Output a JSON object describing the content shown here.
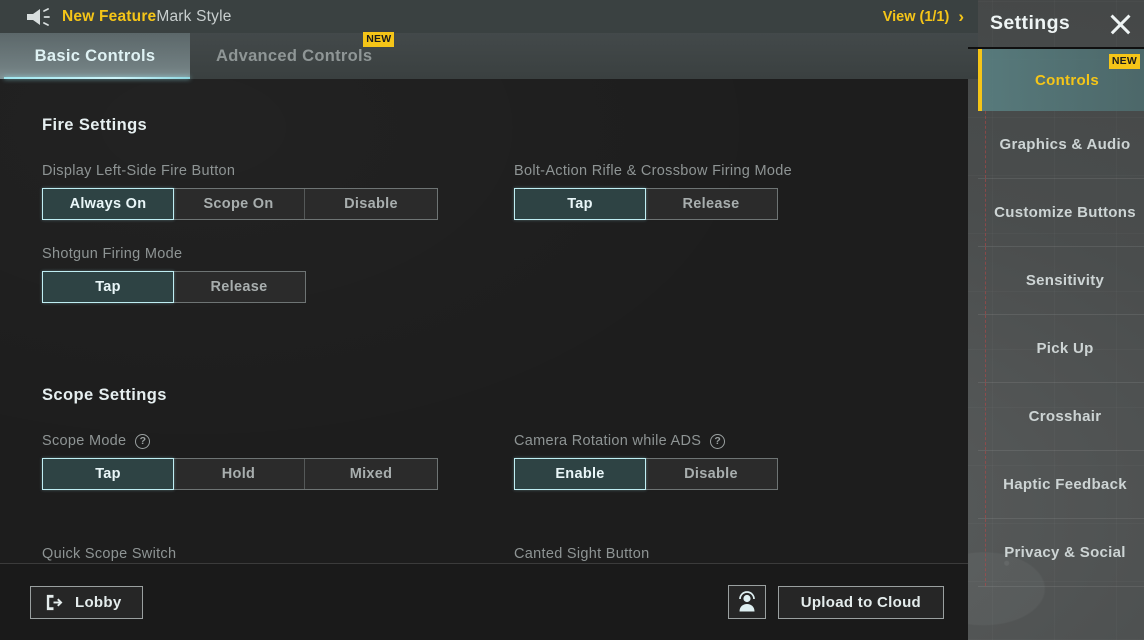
{
  "banner": {
    "icon": "megaphone-icon",
    "new_feature_label": "New Feature",
    "feature_name": "Mark Style",
    "view_label": "View (1/1)",
    "chevron": "›"
  },
  "tabs": [
    {
      "label": "Basic Controls",
      "selected": true,
      "badge": ""
    },
    {
      "label": "Advanced Controls",
      "selected": false,
      "badge": "NEW"
    }
  ],
  "sections": [
    {
      "title": "Fire Settings",
      "rows": [
        {
          "left": {
            "label": "Display Left-Side Fire Button",
            "help": false,
            "options": [
              "Always On",
              "Scope On",
              "Disable"
            ],
            "selected": "Always On"
          },
          "right": {
            "label": "Bolt-Action Rifle & Crossbow Firing Mode",
            "help": false,
            "options": [
              "Tap",
              "Release"
            ],
            "selected": "Tap"
          }
        },
        {
          "left": {
            "label": "Shotgun Firing Mode",
            "help": false,
            "options": [
              "Tap",
              "Release"
            ],
            "selected": "Tap"
          },
          "right": null
        }
      ]
    },
    {
      "title": "Scope Settings",
      "rows": [
        {
          "left": {
            "label": "Scope Mode",
            "help": true,
            "options": [
              "Tap",
              "Hold",
              "Mixed"
            ],
            "selected": "Tap"
          },
          "right": {
            "label": "Camera Rotation while ADS",
            "help": true,
            "options": [
              "Enable",
              "Disable"
            ],
            "selected": "Enable"
          }
        }
      ]
    }
  ],
  "cut_off_labels": {
    "left": "Quick Scope Switch",
    "right": "Canted Sight Button"
  },
  "bottom_bar": {
    "lobby_label": "Lobby",
    "lobby_icon": "exit-icon",
    "support_icon": "customer-support-icon",
    "upload_label": "Upload to Cloud"
  },
  "sidebar": {
    "title": "Settings",
    "close_icon": "close-icon",
    "items": [
      {
        "label": "Controls",
        "selected": true,
        "badge": "NEW"
      },
      {
        "label": "Graphics & Audio",
        "selected": false,
        "badge": ""
      },
      {
        "label": "Customize Buttons",
        "selected": false,
        "badge": ""
      },
      {
        "label": "Sensitivity",
        "selected": false,
        "badge": ""
      },
      {
        "label": "Pick Up",
        "selected": false,
        "badge": ""
      },
      {
        "label": "Crosshair",
        "selected": false,
        "badge": ""
      },
      {
        "label": "Haptic Feedback",
        "selected": false,
        "badge": ""
      },
      {
        "label": "Privacy & Social",
        "selected": false,
        "badge": ""
      }
    ]
  },
  "help_glyph": "?",
  "colors": {
    "accent_yellow": "#f5c518",
    "accent_cyan": "#bfeef3",
    "selected_fill": "#2e4344",
    "panel_bg": "#1d1d1d",
    "sidebar_selected_bg": "#5a8284"
  }
}
